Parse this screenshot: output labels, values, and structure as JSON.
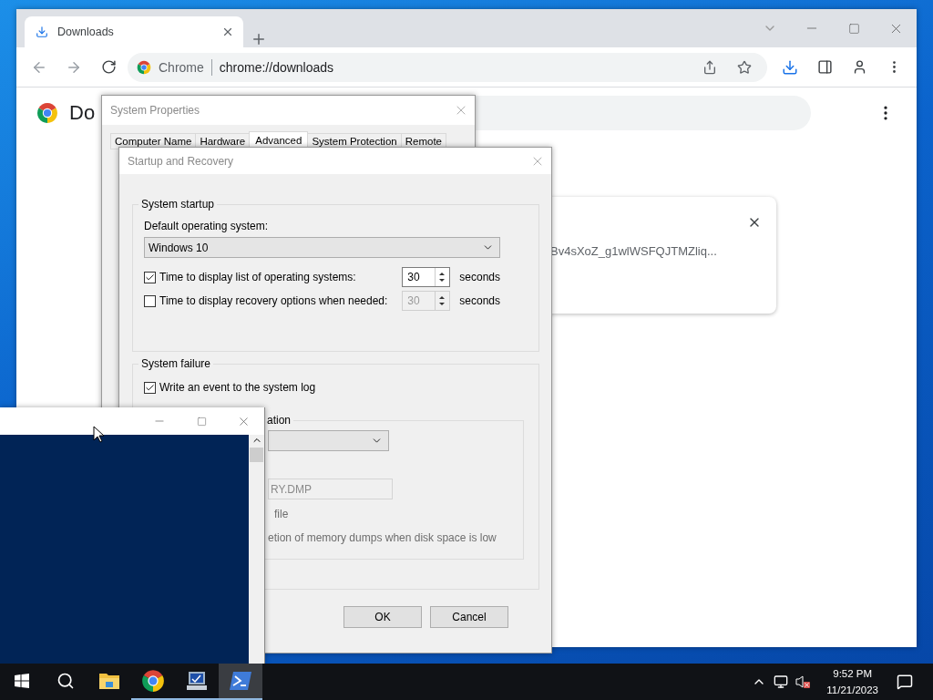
{
  "browser": {
    "tab": {
      "title": "Downloads"
    },
    "omnibox": {
      "site_chip": "Chrome",
      "url": "chrome://downloads"
    },
    "page": {
      "heading": "Do",
      "download": {
        "file_name": "Bv4sXoZ_g1wlWSFQJTMZliq..."
      }
    }
  },
  "system_properties": {
    "title": "System Properties",
    "tabs": [
      {
        "label": "Computer Name",
        "selected": false
      },
      {
        "label": "Hardware",
        "selected": false
      },
      {
        "label": "Advanced",
        "selected": true
      },
      {
        "label": "System Protection",
        "selected": false
      },
      {
        "label": "Remote",
        "selected": false
      }
    ]
  },
  "startup_and_recovery": {
    "title": "Startup and Recovery",
    "system_startup": {
      "legend": "System startup",
      "default_os_label": "Default operating system:",
      "default_os": "Windows 10",
      "timeouts": [
        {
          "label": "Time to display list of operating systems:",
          "checked": true,
          "value": "30",
          "unit": "seconds"
        },
        {
          "label": "Time to display recovery options when needed:",
          "checked": false,
          "value": "30",
          "unit": "seconds"
        }
      ]
    },
    "system_failure": {
      "legend": "System failure",
      "write_event": {
        "label": "Write an event to the system log",
        "checked": true
      },
      "debug_information": {
        "legend": "ation",
        "disabled": true,
        "dump_file": "RY.DMP",
        "overwrite_label": "file",
        "low_disk_label": "etion of memory dumps when disk space is low"
      }
    },
    "buttons": [
      "OK",
      "Cancel"
    ]
  },
  "taskbar": {
    "apps": [
      {
        "kind": "explorer",
        "running": false,
        "selected": false
      },
      {
        "kind": "chrome",
        "running": true,
        "selected": false
      },
      {
        "kind": "system",
        "running": true,
        "selected": false
      },
      {
        "kind": "powershell",
        "running": true,
        "selected": true
      }
    ],
    "clock": {
      "time": "9:52 PM",
      "date": "11/21/2023"
    }
  }
}
